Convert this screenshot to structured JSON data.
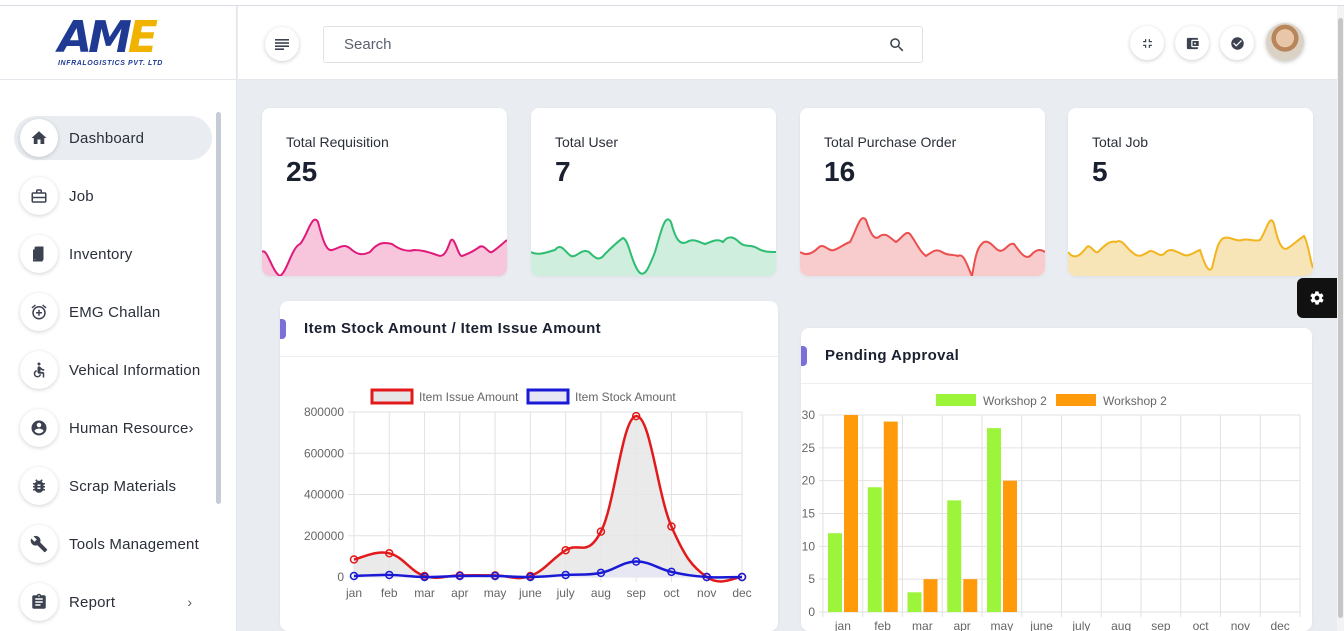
{
  "brand": {
    "logo_letters": "AME",
    "logo_subtitle": "INFRALOGISTICS PVT. LTD"
  },
  "sidebar": {
    "items": [
      {
        "label": "Dashboard",
        "icon": "home-icon",
        "active": true
      },
      {
        "label": "Job",
        "icon": "briefcase-icon"
      },
      {
        "label": "Inventory",
        "icon": "book-icon"
      },
      {
        "label": "EMG Challan",
        "icon": "alarm-add-icon"
      },
      {
        "label": "Vehical Information",
        "icon": "accessible-icon"
      },
      {
        "label": "Human Resource›",
        "icon": "account-circle-icon"
      },
      {
        "label": "Scrap Materials",
        "icon": "bug-icon"
      },
      {
        "label": "Tools Management",
        "icon": "wrench-icon"
      },
      {
        "label": "Report",
        "icon": "report-icon",
        "chevron": "›"
      }
    ]
  },
  "header": {
    "search_placeholder": "Search",
    "buttons": [
      "collapse-icon",
      "wallet-icon",
      "check-circle-icon"
    ]
  },
  "stats": [
    {
      "title": "Total Requisition",
      "value": "25",
      "color": "#e0197a",
      "fill": "#f7c6dc"
    },
    {
      "title": "Total User",
      "value": "7",
      "color": "#2ebd72",
      "fill": "#cfeedd"
    },
    {
      "title": "Total Purchase Order",
      "value": "16",
      "color": "#ec4f4f",
      "fill": "#f8cccc"
    },
    {
      "title": "Total Job",
      "value": "5",
      "color": "#f2b51f",
      "fill": "#f7e5b8"
    }
  ],
  "stock_card": {
    "title": "Item Stock Amount / Item Issue Amount"
  },
  "approval_card": {
    "title": "Pending Approval"
  },
  "chart_data": [
    {
      "type": "line",
      "title": "Item Stock Amount / Item Issue Amount",
      "categories": [
        "jan",
        "feb",
        "mar",
        "apr",
        "may",
        "june",
        "july",
        "aug",
        "sep",
        "oct",
        "nov",
        "dec"
      ],
      "series": [
        {
          "name": "Item Issue Amount",
          "color": "#e31a1c",
          "fill": "#e6e6e6",
          "values": [
            85000,
            115000,
            5000,
            8000,
            8000,
            5000,
            130000,
            220000,
            780000,
            245000,
            0,
            0
          ]
        },
        {
          "name": "Item Stock Amount",
          "color": "#1a1ad6",
          "fill": "#e6e6f5",
          "values": [
            5000,
            10000,
            0,
            5000,
            5000,
            0,
            10000,
            20000,
            75000,
            25000,
            0,
            0
          ]
        }
      ],
      "ylim": [
        0,
        800000
      ],
      "yticks": [
        "0",
        "200000",
        "400000",
        "600000",
        "800000"
      ],
      "grid": true,
      "legend": "top"
    },
    {
      "type": "bar",
      "title": "Pending Approval",
      "categories": [
        "jan",
        "feb",
        "mar",
        "apr",
        "may",
        "june",
        "july",
        "aug",
        "sep",
        "oct",
        "nov",
        "dec"
      ],
      "series": [
        {
          "name": "Workshop 2",
          "color": "#9cf53a",
          "values": [
            12,
            19,
            3,
            17,
            28,
            0,
            0,
            0,
            0,
            0,
            0,
            0
          ]
        },
        {
          "name": "Workshop 2",
          "color": "#ff9a0a",
          "values": [
            30,
            29,
            5,
            5,
            20,
            0,
            0,
            0,
            0,
            0,
            0,
            0
          ]
        }
      ],
      "ylim": [
        0,
        30
      ],
      "yticks": [
        "0",
        "5",
        "10",
        "15",
        "20",
        "25",
        "30"
      ],
      "grid": true,
      "legend": "top"
    }
  ]
}
